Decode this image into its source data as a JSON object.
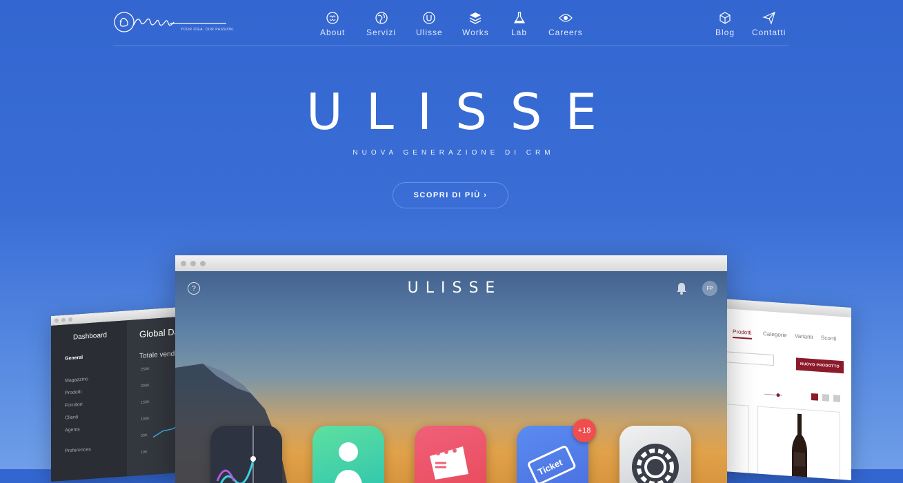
{
  "logo": {
    "name": "Orainin",
    "tagline": "YOUR IDEA. OUR PASSION."
  },
  "nav": {
    "about": "About",
    "servizi": "Servizi",
    "ulisse": "Ulisse",
    "works": "Works",
    "lab": "Lab",
    "careers": "Careers",
    "blog": "Blog",
    "contatti": "Contatti"
  },
  "hero": {
    "title": "ULISSE",
    "subtitle": "NUOVA GENERAZIONE DI CRM",
    "cta": "SCOPRI DI PIÙ ›"
  },
  "left_window": {
    "dashboard": "Dashboard",
    "general": "General",
    "items": [
      "Magazzino",
      "Prodotti",
      "Fornitori",
      "Clienti",
      "Agents"
    ],
    "preferences": "Preferences",
    "title": "Global Da",
    "subtitle": "Totale vendi",
    "ticks": [
      "250K",
      "200K",
      "150K",
      "100K",
      "50K",
      "10K"
    ]
  },
  "right_window": {
    "tabs": [
      "Prodotti",
      "Categorie",
      "Varianti",
      "Sconti"
    ],
    "button": "NUOVO PRODOTTO"
  },
  "main_window": {
    "title": "ULISSE",
    "help": "?",
    "avatar_initials": "FP",
    "badge": "+18",
    "apps": [
      "analytics-app-icon",
      "contacts-app-icon",
      "marketing-app-icon",
      "ticket-app-icon",
      "settings-app-icon"
    ],
    "ticket_text": "Ticket"
  },
  "colors": {
    "background_top": "#3366d0",
    "background_bottom": "#6f9ee8",
    "accent_red": "#8b1a2b",
    "badge": "#f04e4e"
  }
}
